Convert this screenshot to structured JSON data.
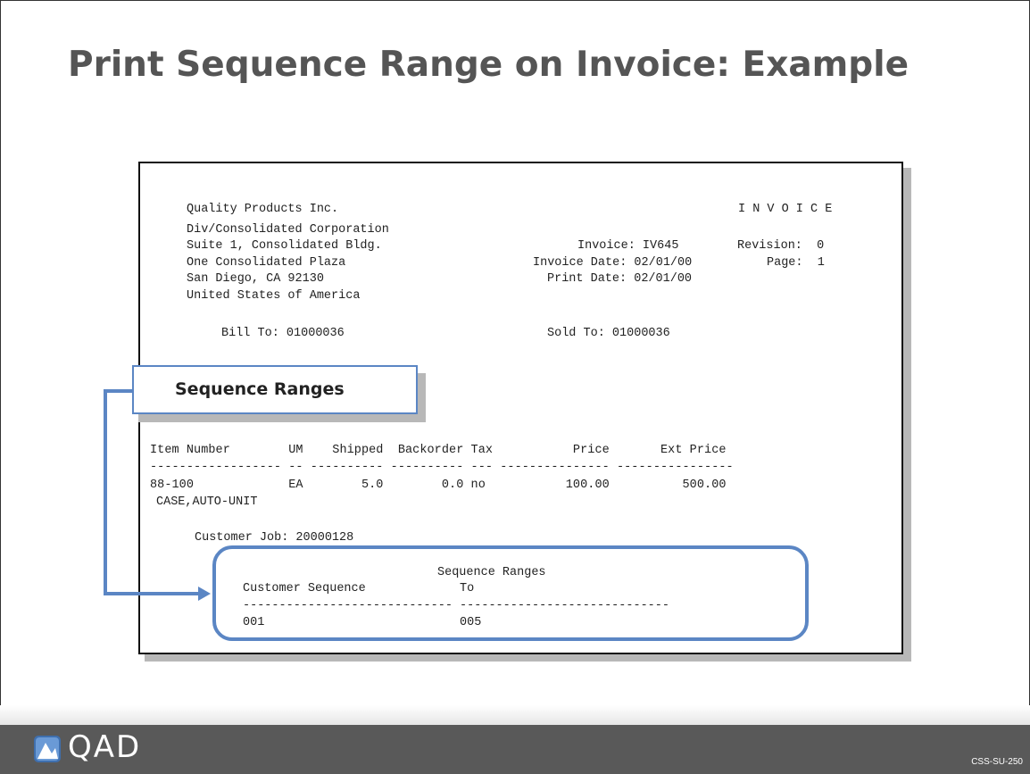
{
  "slide": {
    "title": "Print Sequence Range on Invoice: Example"
  },
  "invoice": {
    "company_lines": [
      "Quality Products Inc.",
      "Div/Consolidated Corporation",
      "Suite 1, Consolidated Bldg.",
      "One Consolidated Plaza",
      "San Diego, CA 92130",
      "United States of America"
    ],
    "doc_type": "I N V O I C E",
    "invoice_line": "Invoice: IV645",
    "revision_line": "Revision:  0",
    "invoice_date_line": "Invoice Date: 02/01/00",
    "page_line": "Page:  1",
    "print_date_line": "Print Date: 02/01/00",
    "bill_to": "Bill To: 01000036",
    "sold_to": "Sold To: 01000036",
    "table_header": "Item Number        UM    Shipped  Backorder Tax           Price       Ext Price",
    "table_rule": "------------------ -- ---------- ---------- --- --------------- ----------------",
    "row_main": "88-100             EA        5.0        0.0 no           100.00          500.00",
    "row_desc": "CASE,AUTO-UNIT",
    "customer_job": "Customer Job: 20000128",
    "seq_title": "Sequence Ranges",
    "seq_header": "Customer Sequence             To",
    "seq_rule": "----------------------------- -----------------------------",
    "seq_row": "001                           005"
  },
  "callout": {
    "label": "Sequence Ranges"
  },
  "footer": {
    "logo_text": "QAD",
    "code": "CSS-SU-250"
  },
  "colors": {
    "accent": "#5b86c4",
    "title": "#555555",
    "footer_bg": "#595959"
  }
}
